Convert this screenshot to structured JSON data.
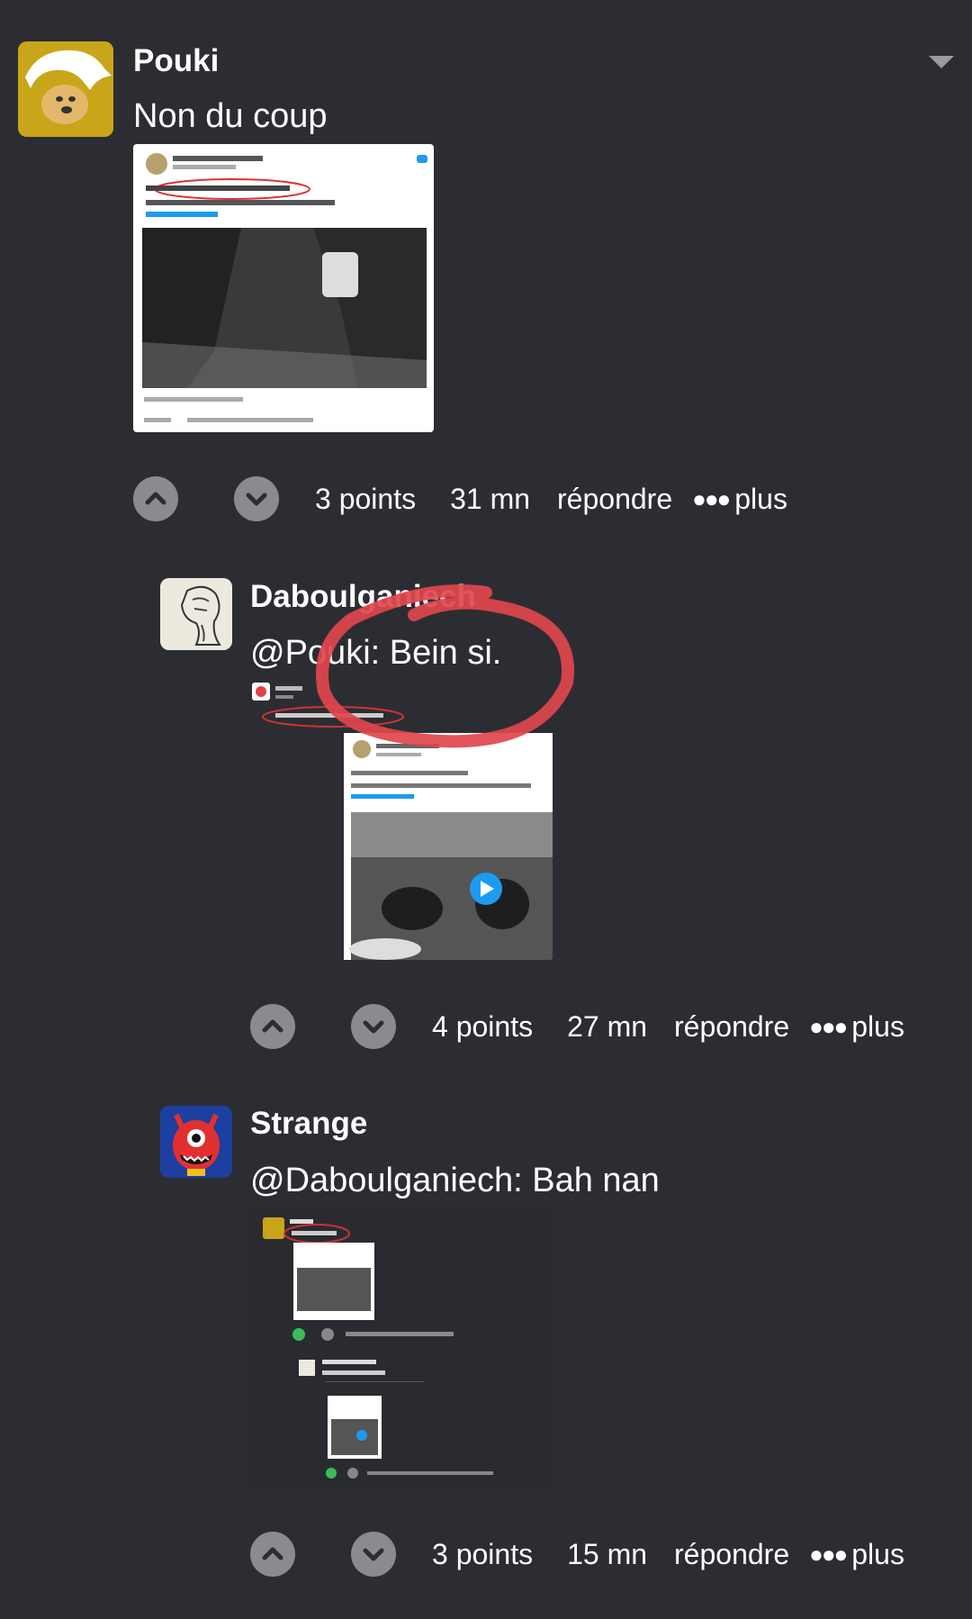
{
  "comments": [
    {
      "author": "Pouki",
      "text": "Non du coup",
      "points": "3 points",
      "time": "31 mn",
      "reply_label": "répondre",
      "more_label": "plus",
      "avatar_icon": "doge-avatar",
      "attachment_icon": "tweet-screenshot-thumbnail",
      "colors": {
        "avatar_bg": "#c9a51a"
      }
    },
    {
      "author": "Daboulganiech",
      "text": "@Pouki: Bein si.",
      "points": "4 points",
      "time": "27 mn",
      "reply_label": "répondre",
      "more_label": "plus",
      "avatar_icon": "sketch-avatar",
      "attachment_icon": "tweet-screenshot-thumbnail"
    },
    {
      "author": "Strange",
      "text": "@Daboulganiech: Bah nan",
      "points": "3 points",
      "time": "15 mn",
      "reply_label": "répondre",
      "more_label": "plus",
      "avatar_icon": "red-monster-avatar",
      "attachment_icon": "app-screenshot-thumbnail"
    }
  ],
  "colors": {
    "background": "#2c2d33",
    "vote_button": "#8a8b91",
    "annotation_red": "#e0474c",
    "twitter_blue": "#1d9bf0"
  }
}
